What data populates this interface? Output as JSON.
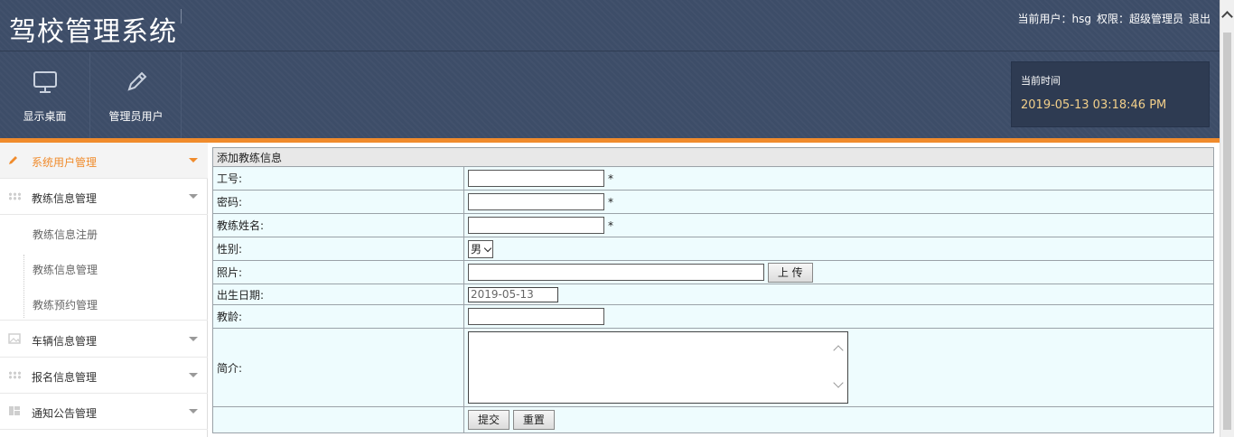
{
  "app": {
    "title": "驾校管理系统"
  },
  "userbar": {
    "current_user": "当前用户：hsg",
    "role": "权限：超级管理员",
    "logout": "退出"
  },
  "topnav": [
    {
      "label": "显示桌面",
      "icon": "monitor-icon"
    },
    {
      "label": "管理员用户",
      "icon": "pencil-icon"
    }
  ],
  "timebox": {
    "label": "当前时间",
    "value": "2019-05-13 03:18:46 PM"
  },
  "colors": {
    "header": "#3d4d68",
    "accent": "#f08b2c",
    "time": "#f3d08a",
    "form_bg": "#eefcfe"
  },
  "sidebar": {
    "items": [
      {
        "label": "系统用户管理",
        "icon": "pencil-icon"
      },
      {
        "label": "教练信息管理",
        "icon": "grid-icon"
      },
      {
        "label": "车辆信息管理",
        "icon": "image-icon"
      },
      {
        "label": "报名信息管理",
        "icon": "grid-icon"
      },
      {
        "label": "通知公告管理",
        "icon": "layout-icon"
      }
    ],
    "subitems": [
      "教练信息注册",
      "教练信息管理",
      "教练预约管理"
    ]
  },
  "form": {
    "heading": "添加教练信息",
    "fields": {
      "gonghao": "工号:",
      "mima": "密码:",
      "xingming": "教练姓名:",
      "xingbie": "性别:",
      "zhaopian": "照片:",
      "shengri": "出生日期:",
      "jiaoling": "教龄:",
      "jianjie": "简介:"
    },
    "required_mark": "*",
    "gender_value": "男",
    "upload_label": "上 传",
    "birth_value": "2019-05-13",
    "submit_label": "提交",
    "reset_label": "重置"
  }
}
